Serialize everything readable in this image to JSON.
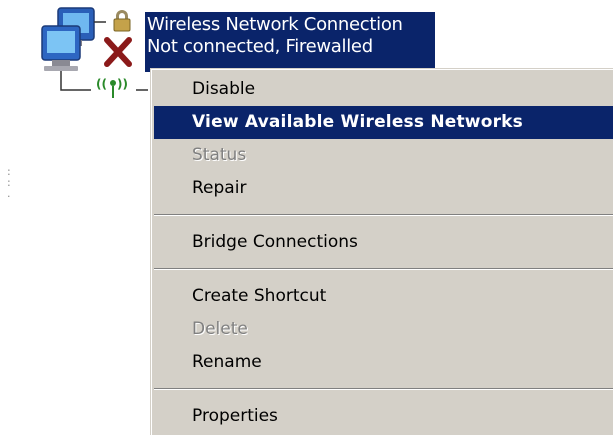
{
  "connection": {
    "name": "Wireless Network Connection",
    "status": "Not connected, Firewalled"
  },
  "menu": {
    "items": [
      {
        "label": "Disable",
        "state": "normal"
      },
      {
        "label": "View Available Wireless Networks",
        "state": "highlighted"
      },
      {
        "label": "Status",
        "state": "disabled"
      },
      {
        "label": "Repair",
        "state": "normal"
      },
      {
        "label": "Bridge Connections",
        "state": "normal"
      },
      {
        "label": "Create Shortcut",
        "state": "normal"
      },
      {
        "label": "Delete",
        "state": "disabled"
      },
      {
        "label": "Rename",
        "state": "normal"
      },
      {
        "label": "Properties",
        "state": "normal"
      }
    ]
  },
  "colors": {
    "selection": "#0a246a",
    "menu_background": "#d4d0c8",
    "disabled_text": "#808080",
    "error_x": "#8b1a1a"
  },
  "icons": [
    "network-computers-icon",
    "lock-icon",
    "disconnected-x-icon",
    "wireless-signal-icon"
  ]
}
